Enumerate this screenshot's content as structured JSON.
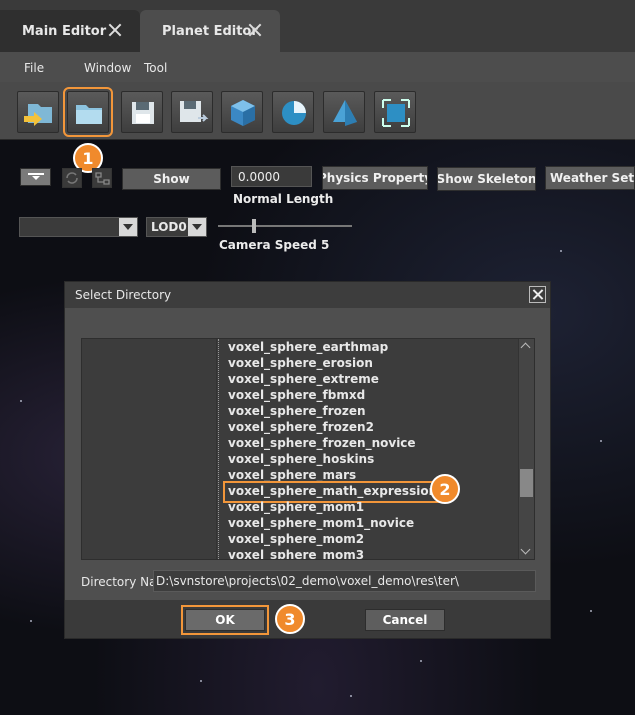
{
  "tabs": [
    {
      "label": "Main Editor"
    },
    {
      "label": "Planet Editor"
    }
  ],
  "menu": [
    "File",
    "Window",
    "Tool"
  ],
  "toolbar_icons": [
    "open-into-icon",
    "open-folder-icon",
    "save-icon",
    "save-as-icon",
    "cube-icon",
    "sphere-icon",
    "pyramid-icon",
    "transform-icon"
  ],
  "controls": {
    "show_label": "Show",
    "normal_length_value": "0.0000",
    "normal_length_label": "Normal Length",
    "physics_property_label": "Physics Property",
    "show_skeleton_label": "Show Skeleton",
    "weather_settings_label": "Weather Settin",
    "lod_value": "LOD0",
    "camera_speed_label": "Camera Speed 5"
  },
  "badges": [
    "1",
    "2",
    "3"
  ],
  "dialog": {
    "title": "Select Directory",
    "items": [
      "voxel_sphere_earthmap",
      "voxel_sphere_erosion",
      "voxel_sphere_extreme",
      "voxel_sphere_fbmxd",
      "voxel_sphere_frozen",
      "voxel_sphere_frozen2",
      "voxel_sphere_frozen_novice",
      "voxel_sphere_hoskins",
      "voxel_sphere_mars",
      "voxel_sphere_math_expression",
      "voxel_sphere_mom1",
      "voxel_sphere_mom1_novice",
      "voxel_sphere_mom2",
      "voxel_sphere_mom3"
    ],
    "selected_item": "voxel_sphere_math_expression",
    "directory_label": "Directory Na",
    "directory_value": "D:\\svnstore\\projects\\02_demo\\voxel_demo\\res\\ter\\",
    "ok_label": "OK",
    "cancel_label": "Cancel"
  },
  "colors": {
    "highlight": "#f2963a",
    "badge": "#f08a2c"
  }
}
